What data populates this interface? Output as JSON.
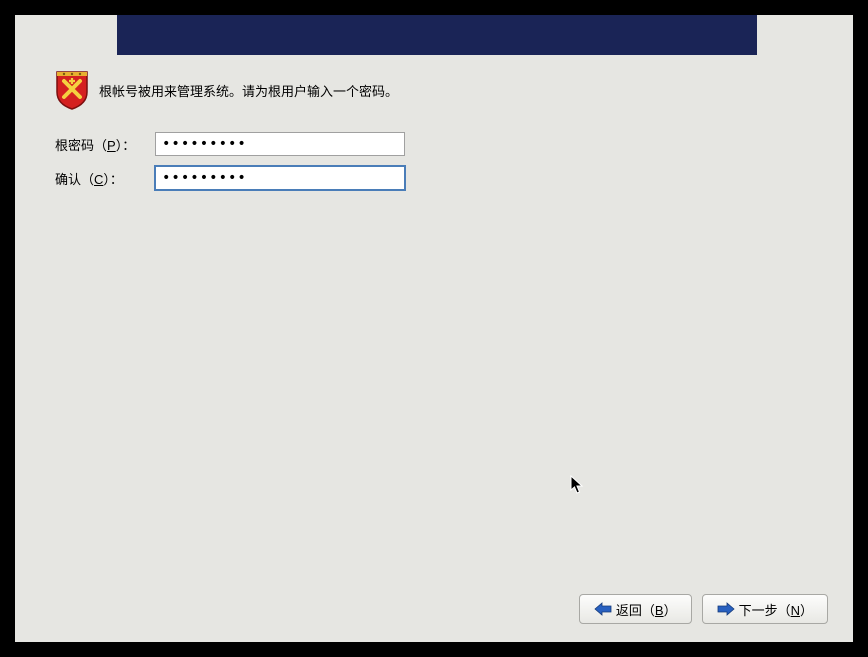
{
  "info": {
    "text": "根帐号被用来管理系统。请为根用户输入一个密码。"
  },
  "form": {
    "password_label_pre": "根密码（",
    "password_label_key": "P",
    "password_label_post": "）：",
    "password_value": "•••••••••",
    "confirm_label_pre": "确认（",
    "confirm_label_key": "C",
    "confirm_label_post": "）：",
    "confirm_value": "•••••••••"
  },
  "buttons": {
    "back_pre": "返回（",
    "back_key": "B",
    "back_post": "）",
    "next_pre": "下一步（",
    "next_key": "N",
    "next_post": "）"
  }
}
